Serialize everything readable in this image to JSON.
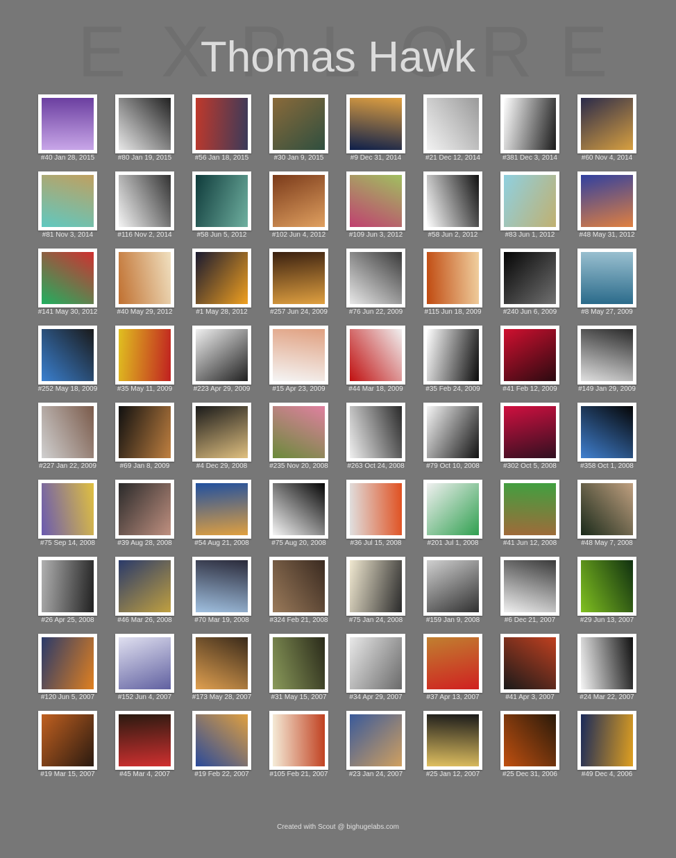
{
  "page": {
    "title": "Thomas Hawk",
    "background_word": [
      "E",
      "X",
      "P",
      "L",
      "O",
      "R",
      "E"
    ],
    "footer": "Created with Scout @ bighugelabs.com",
    "colors": {
      "background": "#777777",
      "frame": "#ffffff",
      "caption": "#e8e8e8"
    }
  },
  "photos": [
    {
      "caption": "#40 Jan 28, 2015",
      "colors": [
        "#c8a6e8",
        "#6b3fa0"
      ]
    },
    {
      "caption": "#80 Jan 19, 2015",
      "colors": [
        "#e8e8e8",
        "#222222"
      ]
    },
    {
      "caption": "#56 Jan 18, 2015",
      "colors": [
        "#c0392b",
        "#3a3a5a"
      ]
    },
    {
      "caption": "#30 Jan 9, 2015",
      "colors": [
        "#8a6a3a",
        "#2f4f3f"
      ]
    },
    {
      "caption": "#9 Dec 31, 2014",
      "colors": [
        "#0d1f4a",
        "#e0a040"
      ]
    },
    {
      "caption": "#21 Dec 12, 2014",
      "colors": [
        "#f2f2f2",
        "#9a9a9a"
      ]
    },
    {
      "caption": "#381 Dec 3, 2014",
      "colors": [
        "#ffffff",
        "#1a1a1a"
      ]
    },
    {
      "caption": "#60 Nov 4, 2014",
      "colors": [
        "#2a2a4a",
        "#d8a040"
      ]
    },
    {
      "caption": "#81 Nov 3, 2014",
      "colors": [
        "#5fc8c0",
        "#c0a060"
      ]
    },
    {
      "caption": "#116 Nov 2, 2014",
      "colors": [
        "#f5f5f5",
        "#333333"
      ]
    },
    {
      "caption": "#58 Jun 5, 2012",
      "colors": [
        "#0f3b3b",
        "#6fb0a0"
      ]
    },
    {
      "caption": "#102 Jun 4, 2012",
      "colors": [
        "#7a3a1a",
        "#e0a060"
      ]
    },
    {
      "caption": "#109 Jun 3, 2012",
      "colors": [
        "#c04070",
        "#a0c060"
      ]
    },
    {
      "caption": "#58 Jun 2, 2012",
      "colors": [
        "#ffffff",
        "#111111"
      ]
    },
    {
      "caption": "#83 Jun 1, 2012",
      "colors": [
        "#8fd0e0",
        "#c0b070"
      ]
    },
    {
      "caption": "#48 May 31, 2012",
      "colors": [
        "#3040a0",
        "#e08040"
      ]
    },
    {
      "caption": "#141 May 30, 2012",
      "colors": [
        "#20b060",
        "#d03030"
      ]
    },
    {
      "caption": "#40 May 29, 2012",
      "colors": [
        "#c07030",
        "#f0e0c0"
      ]
    },
    {
      "caption": "#1 May 28, 2012",
      "colors": [
        "#1a1a30",
        "#f0a020"
      ]
    },
    {
      "caption": "#257 Jun 24, 2009",
      "colors": [
        "#3a2010",
        "#e0a040"
      ]
    },
    {
      "caption": "#76 Jun 22, 2009",
      "colors": [
        "#e8e8e8",
        "#3a3a3a"
      ]
    },
    {
      "caption": "#115 Jun 18, 2009",
      "colors": [
        "#c04a10",
        "#f0d0a0"
      ]
    },
    {
      "caption": "#240 Jun 6, 2009",
      "colors": [
        "#050505",
        "#707070"
      ]
    },
    {
      "caption": "#8 May 27, 2009",
      "colors": [
        "#2a6a8a",
        "#9ac0d0"
      ]
    },
    {
      "caption": "#252 May 18, 2009",
      "colors": [
        "#3a80d0",
        "#1a1a1a"
      ]
    },
    {
      "caption": "#35 May 11, 2009",
      "colors": [
        "#e0c020",
        "#c02020"
      ]
    },
    {
      "caption": "#223 Apr 29, 2009",
      "colors": [
        "#f0f0f0",
        "#202020"
      ]
    },
    {
      "caption": "#15 Apr 23, 2009",
      "colors": [
        "#f5f5f5",
        "#e0a080"
      ]
    },
    {
      "caption": "#44 Mar 18, 2009",
      "colors": [
        "#c01010",
        "#f0f0f0"
      ]
    },
    {
      "caption": "#35 Feb 24, 2009",
      "colors": [
        "#ffffff",
        "#0a0a0a"
      ]
    },
    {
      "caption": "#41 Feb 12, 2009",
      "colors": [
        "#d01030",
        "#2a0a10"
      ]
    },
    {
      "caption": "#149 Jan 29, 2009",
      "colors": [
        "#e0e0e0",
        "#2a2a2a"
      ]
    },
    {
      "caption": "#227 Jan 22, 2009",
      "colors": [
        "#d0d0d0",
        "#7a5a4a"
      ]
    },
    {
      "caption": "#69 Jan 8, 2009",
      "colors": [
        "#101010",
        "#c08040"
      ]
    },
    {
      "caption": "#4 Dec 29, 2008",
      "colors": [
        "#1a1a1a",
        "#e0c080"
      ]
    },
    {
      "caption": "#235 Nov 20, 2008",
      "colors": [
        "#6a8a3a",
        "#e080a0"
      ]
    },
    {
      "caption": "#263 Oct 24, 2008",
      "colors": [
        "#f0f0f0",
        "#2a2a2a"
      ]
    },
    {
      "caption": "#79 Oct 10, 2008",
      "colors": [
        "#f5f5f5",
        "#111111"
      ]
    },
    {
      "caption": "#302 Oct 5, 2008",
      "colors": [
        "#d01040",
        "#301020"
      ]
    },
    {
      "caption": "#358 Oct 1, 2008",
      "colors": [
        "#4080d0",
        "#050505"
      ]
    },
    {
      "caption": "#75 Sep 14, 2008",
      "colors": [
        "#6a5ab0",
        "#e0c040"
      ]
    },
    {
      "caption": "#39 Aug 28, 2008",
      "colors": [
        "#2a2a2a",
        "#c09080"
      ]
    },
    {
      "caption": "#54 Aug 21, 2008",
      "colors": [
        "#2050a0",
        "#e0a040"
      ]
    },
    {
      "caption": "#75 Aug 20, 2008",
      "colors": [
        "#f5f5f5",
        "#050505"
      ]
    },
    {
      "caption": "#36 Jul 15, 2008",
      "colors": [
        "#e0e0e0",
        "#e05020"
      ]
    },
    {
      "caption": "#201 Jul 1, 2008",
      "colors": [
        "#f0f0f0",
        "#30a050"
      ]
    },
    {
      "caption": "#41 Jun 12, 2008",
      "colors": [
        "#a06a3a",
        "#40a040"
      ]
    },
    {
      "caption": "#48 May 7, 2008",
      "colors": [
        "#1a2a1a",
        "#c0a080"
      ]
    },
    {
      "caption": "#26 Apr 25, 2008",
      "colors": [
        "#b0b0b0",
        "#202020"
      ]
    },
    {
      "caption": "#46 Mar 26, 2008",
      "colors": [
        "#2a3a6a",
        "#c0a040"
      ]
    },
    {
      "caption": "#70 Mar 19, 2008",
      "colors": [
        "#a0c0e0",
        "#2a2a3a"
      ]
    },
    {
      "caption": "#324 Feb 21, 2008",
      "colors": [
        "#9a7a5a",
        "#3a2a20"
      ]
    },
    {
      "caption": "#75 Jan 24, 2008",
      "colors": [
        "#f0e8d0",
        "#2a2a2a"
      ]
    },
    {
      "caption": "#159 Jan 9, 2008",
      "colors": [
        "#d0d0d0",
        "#303030"
      ]
    },
    {
      "caption": "#6 Dec 21, 2007",
      "colors": [
        "#f0f0f0",
        "#3a3a3a"
      ]
    },
    {
      "caption": "#29 Jun 13, 2007",
      "colors": [
        "#80c020",
        "#103010"
      ]
    },
    {
      "caption": "#120 Jun 5, 2007",
      "colors": [
        "#2a3a6a",
        "#e08020"
      ]
    },
    {
      "caption": "#152 Jun 4, 2007",
      "colors": [
        "#e0e0f0",
        "#6060a0"
      ]
    },
    {
      "caption": "#173 May 28, 2007",
      "colors": [
        "#e0a050",
        "#3a2a1a"
      ]
    },
    {
      "caption": "#31 May 15, 2007",
      "colors": [
        "#8a9a5a",
        "#2a2a1a"
      ]
    },
    {
      "caption": "#34 Apr 29, 2007",
      "colors": [
        "#e8e8e8",
        "#6a6a6a"
      ]
    },
    {
      "caption": "#37 Apr 13, 2007",
      "colors": [
        "#c08030",
        "#d02020"
      ]
    },
    {
      "caption": "#41 Apr 3, 2007",
      "colors": [
        "#1a1a1a",
        "#c04020"
      ]
    },
    {
      "caption": "#24 Mar 22, 2007",
      "colors": [
        "#f5f5f5",
        "#101010"
      ]
    },
    {
      "caption": "#19 Mar 15, 2007",
      "colors": [
        "#c06020",
        "#2a1a10"
      ]
    },
    {
      "caption": "#45 Mar 4, 2007",
      "colors": [
        "#2a1a10",
        "#d03030"
      ]
    },
    {
      "caption": "#19 Feb 22, 2007",
      "colors": [
        "#2a4a9a",
        "#e0a040"
      ]
    },
    {
      "caption": "#105 Feb 21, 2007",
      "colors": [
        "#f5ecd8",
        "#c04020"
      ]
    },
    {
      "caption": "#23 Jan 24, 2007",
      "colors": [
        "#3a5a9a",
        "#d0a060"
      ]
    },
    {
      "caption": "#25 Jan 12, 2007",
      "colors": [
        "#e0c060",
        "#1a1a1a"
      ]
    },
    {
      "caption": "#25 Dec 31, 2006",
      "colors": [
        "#c05010",
        "#2a1a0a"
      ]
    },
    {
      "caption": "#49 Dec 4, 2006",
      "colors": [
        "#1a2a5a",
        "#e0a020"
      ]
    }
  ]
}
